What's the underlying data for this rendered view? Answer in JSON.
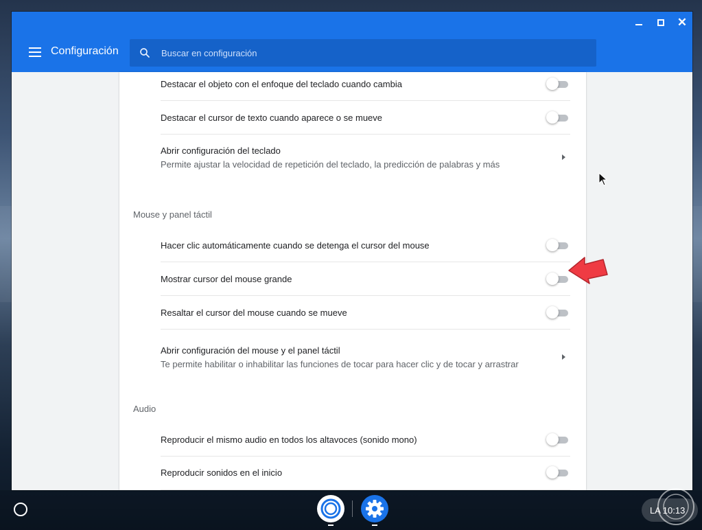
{
  "window": {
    "controls": {
      "minimize": "minimize-icon",
      "maximize": "maximize-icon",
      "close": "✕"
    }
  },
  "appbar": {
    "title": "Configuración",
    "search_placeholder": "Buscar en configuración"
  },
  "sections": {
    "keyboard_rows": [
      {
        "label": "Destacar el objeto con el enfoque del teclado cuando cambia",
        "toggle_on": false
      },
      {
        "label": "Destacar el cursor de texto cuando aparece o se mueve",
        "toggle_on": false
      }
    ],
    "keyboard_link": {
      "label": "Abrir configuración del teclado",
      "sub": "Permite ajustar la velocidad de repetición del teclado, la predicción de palabras y más"
    },
    "mouse": {
      "title": "Mouse y panel táctil",
      "rows": [
        {
          "label": "Hacer clic automáticamente cuando se detenga el cursor del mouse",
          "toggle_on": false
        },
        {
          "label": "Mostrar cursor del mouse grande",
          "toggle_on": false
        },
        {
          "label": "Resaltar el cursor del mouse cuando se mueve",
          "toggle_on": false
        }
      ],
      "link": {
        "label": "Abrir configuración del mouse y el panel táctil",
        "sub": "Te permite habilitar o inhabilitar las funciones de tocar para hacer clic y de tocar y arrastrar"
      }
    },
    "audio": {
      "title": "Audio",
      "rows": [
        {
          "label": "Reproducir el mismo audio en todos los altavoces (sonido mono)",
          "toggle_on": false
        },
        {
          "label": "Reproducir sonidos en el inicio",
          "toggle_on": false
        }
      ]
    }
  },
  "shelf": {
    "apps": [
      "chrome-icon",
      "settings-icon"
    ],
    "status_text": "LA 10:13"
  },
  "colors": {
    "accent": "#1a73e8",
    "annotation_arrow": "#ef3b43"
  }
}
